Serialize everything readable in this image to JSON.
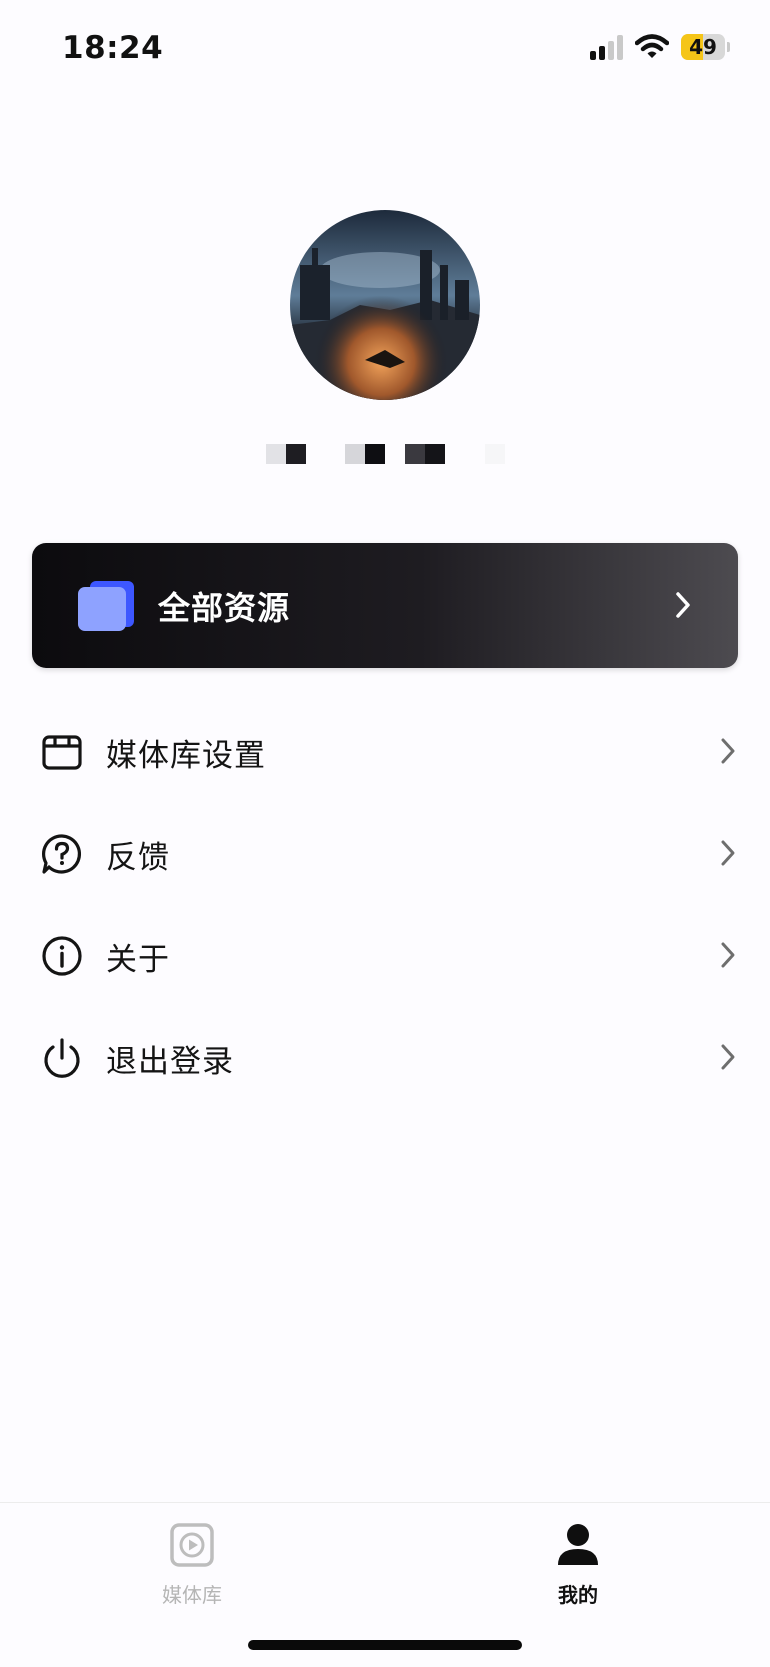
{
  "status_bar": {
    "time": "18:24",
    "battery_level": "49",
    "battery_fraction": 0.49,
    "battery_color": "#f5c518",
    "icons": [
      "cellular-signal-icon",
      "wifi-icon",
      "battery-icon"
    ]
  },
  "profile": {
    "avatar": "avatar-image",
    "username_pixelated": true
  },
  "all_resources": {
    "label": "全部资源",
    "icon": "folder-icon",
    "accent": "#6f86ff"
  },
  "menu": {
    "items": [
      {
        "label": "媒体库设置",
        "icon": "media-library-icon"
      },
      {
        "label": "反馈",
        "icon": "feedback-icon"
      },
      {
        "label": "关于",
        "icon": "info-icon"
      },
      {
        "label": "退出登录",
        "icon": "power-icon"
      }
    ]
  },
  "tab_bar": {
    "tabs": [
      {
        "label": "媒体库",
        "icon": "play-icon",
        "active": false
      },
      {
        "label": "我的",
        "icon": "person-icon",
        "active": true
      }
    ]
  }
}
